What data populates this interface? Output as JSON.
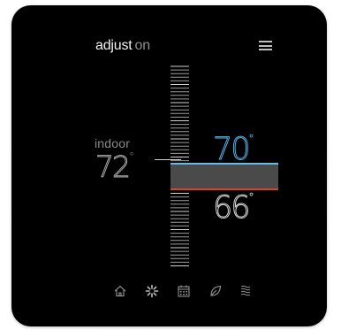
{
  "header": {
    "title_prefix": "adjust",
    "title_suffix": "on",
    "menu_icon": "hamburger-menu-icon"
  },
  "indoor": {
    "label": "indoor",
    "temperature": "72",
    "unit": "°"
  },
  "setpoints": {
    "cool": "70",
    "heat": "66",
    "unit": "°",
    "cool_color": "#55b3e8",
    "heat_color": "#d8442b"
  },
  "bottom_nav": [
    {
      "name": "home-icon"
    },
    {
      "name": "fan-icon"
    },
    {
      "name": "schedule-icon"
    },
    {
      "name": "leaf-icon"
    },
    {
      "name": "heat-waves-icon"
    }
  ],
  "colors": {
    "background": "#000000",
    "text_primary": "#f2f2f2",
    "text_muted": "#8f8f8f"
  }
}
